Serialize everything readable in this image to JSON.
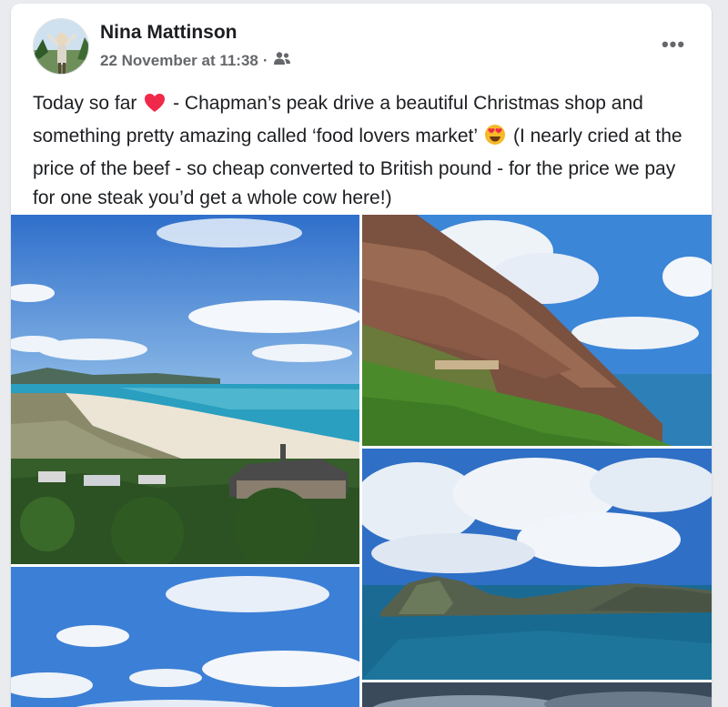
{
  "post": {
    "author": "Nina Mattinson",
    "timestamp": "22 November at 11:38",
    "separator": "·",
    "audience_icon": "friends-icon",
    "more_label": "•••",
    "text_parts": {
      "p1": "Today so far",
      "p2": "- Chapman’s peak drive a beautiful Christmas shop and something pretty amazing called ‘food lovers market’",
      "p3": "(I nearly cried at the price of the beef - so cheap converted to British pound - for the price we pay for one steak you’d get a whole cow here!)"
    },
    "emojis": [
      "red-heart-emoji",
      "heart-eyes-emoji"
    ]
  },
  "photos": [
    {
      "name": "photo-beach-bay",
      "depicts": "beach-coastline-house"
    },
    {
      "name": "photo-mountain-cliff",
      "depicts": "mountain-cliff-road"
    },
    {
      "name": "photo-bay-mountains",
      "depicts": "bay-clouds-mountains"
    },
    {
      "name": "photo-sky-clouds",
      "depicts": "sky-clouds"
    },
    {
      "name": "photo-partial-bottom",
      "depicts": "partial-photo"
    }
  ],
  "colors": {
    "card_bg": "#ffffff",
    "page_bg": "#e9ebee",
    "name_text": "#1c1e21",
    "meta_text": "#65676b",
    "sky": "#3a7fd4",
    "ocean": "#1f8fb0",
    "vegetation": "#3f6a2a"
  }
}
